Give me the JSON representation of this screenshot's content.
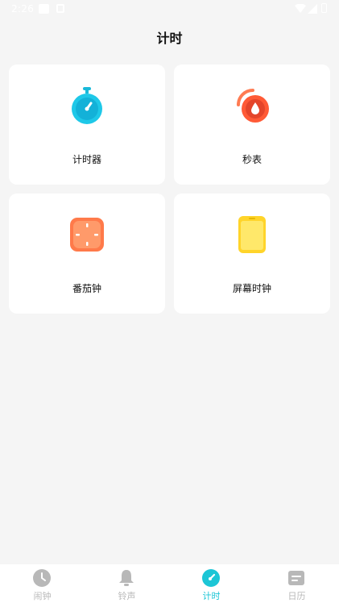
{
  "status_bar": {
    "time": "2:26"
  },
  "header": {
    "title": "计时"
  },
  "cards": [
    {
      "label": "计时器",
      "icon": "stopwatch-icon",
      "color": "#1ec8e8"
    },
    {
      "label": "秒表",
      "icon": "stopwatch-drop-icon",
      "color": "#ff6a3d"
    },
    {
      "label": "番茄钟",
      "icon": "tomato-clock-icon",
      "color": "#ff8a5c"
    },
    {
      "label": "屏幕时钟",
      "icon": "screen-clock-icon",
      "color": "#ffd93a"
    }
  ],
  "bottom_nav": {
    "items": [
      {
        "label": "闹钟",
        "icon": "clock-icon",
        "active": false
      },
      {
        "label": "铃声",
        "icon": "bell-icon",
        "active": false
      },
      {
        "label": "计时",
        "icon": "timer-icon",
        "active": true
      },
      {
        "label": "日历",
        "icon": "calendar-icon",
        "active": false
      }
    ],
    "active_color": "#1cc6d6",
    "inactive_color": "#b8b8b8"
  }
}
